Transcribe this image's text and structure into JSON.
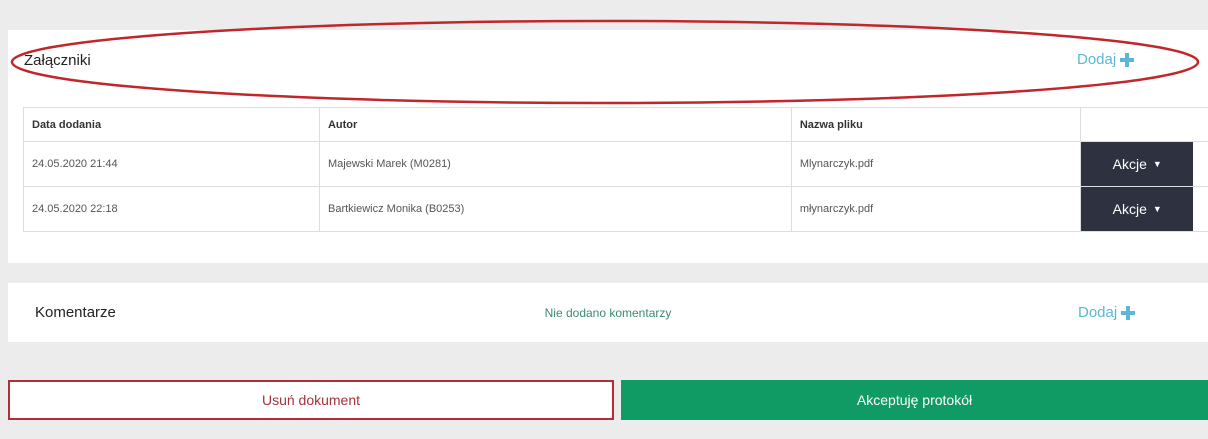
{
  "attachments": {
    "title": "Załączniki",
    "add_label": "Dodaj",
    "columns": [
      "Data dodania",
      "Autor",
      "Nazwa pliku"
    ],
    "rows": [
      {
        "date": "24.05.2020 21:44",
        "author": "Majewski Marek (M0281)",
        "filename": "Mlynarczyk.pdf",
        "action": "Akcje"
      },
      {
        "date": "24.05.2020 22:18",
        "author": "Bartkiewicz Monika (B0253)",
        "filename": "młynarczyk.pdf",
        "action": "Akcje"
      }
    ]
  },
  "comments": {
    "title": "Komentarze",
    "empty_text": "Nie dodano komentarzy",
    "add_label": "Dodaj"
  },
  "footer": {
    "delete_label": "Usuń dokument",
    "accept_label": "Akceptuję protokół"
  },
  "colors": {
    "accent_link": "#5bb8d4",
    "accept_green": "#0f9b63",
    "delete_red": "#b02e35",
    "action_dark": "#2e3240",
    "annotation_red": "#c0262c"
  }
}
